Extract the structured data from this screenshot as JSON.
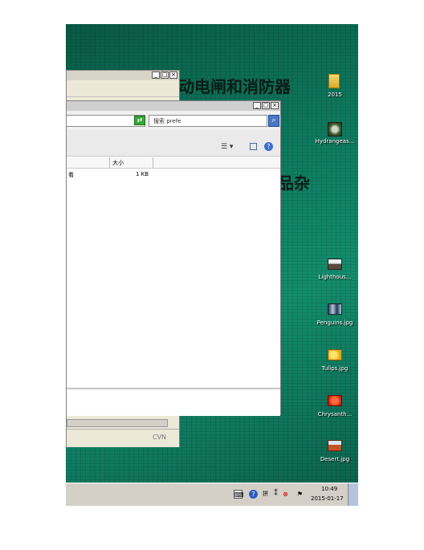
{
  "wallpaper": {
    "text_line1": "动电闸和消防器",
    "text_line2": "品杂"
  },
  "back_window": {
    "status": "CVN"
  },
  "explorer": {
    "search_placeholder": "搜索 prefe",
    "columns": [
      "",
      "大小"
    ],
    "rows": [
      {
        "name": "看",
        "size": "1 KB"
      }
    ]
  },
  "desktop_icons": [
    {
      "label": "2015",
      "icon": "folder-icon"
    },
    {
      "label": "Hydrangeas...",
      "icon": "image-icon"
    },
    {
      "label": "Lighthous...",
      "icon": "image-icon"
    },
    {
      "label": "Penguins.jpg",
      "icon": "image-icon"
    },
    {
      "label": "Tulips.jpg",
      "icon": "image-icon"
    },
    {
      "label": "Chrysanth...",
      "icon": "image-icon"
    },
    {
      "label": "Desert.jpg",
      "icon": "image-icon"
    }
  ],
  "taskbar": {
    "time": "10:49",
    "date": "2015-01-17"
  }
}
